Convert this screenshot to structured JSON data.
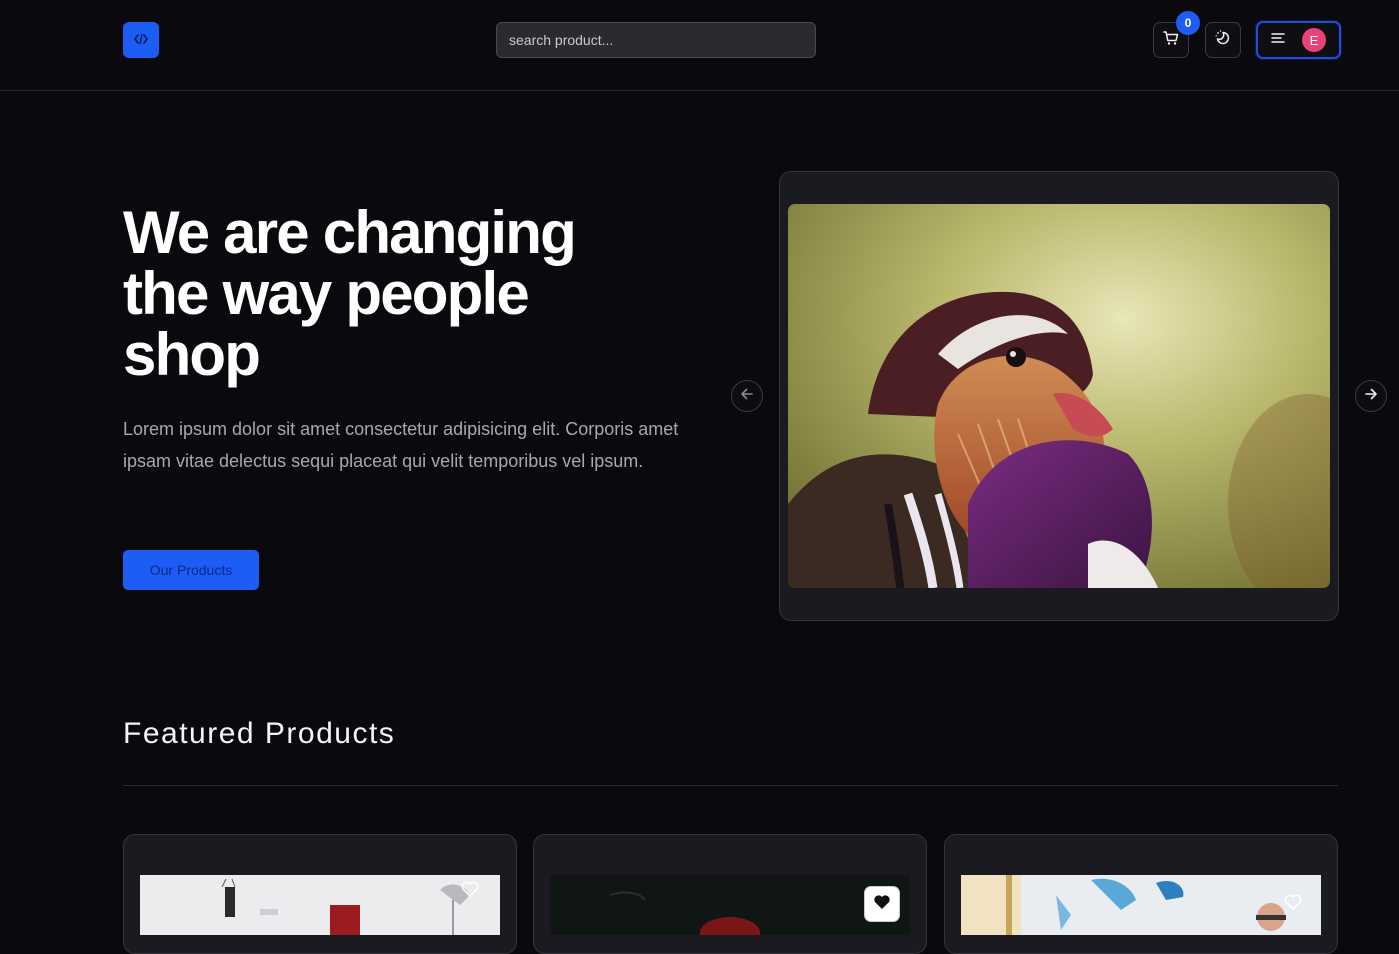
{
  "header": {
    "search_placeholder": "search product...",
    "cart_count": "0",
    "user_initial": "E"
  },
  "hero": {
    "title": "We are changing the way people shop",
    "description": "Lorem ipsum dolor sit amet consectetur adipisicing elit. Corporis amet ipsam vitae delectus sequi placeat qui velit temporibus vel ipsum.",
    "cta_label": "Our Products"
  },
  "featured": {
    "title": "Featured Products",
    "cards": [
      {
        "favorite_icon": "heart-outline-icon"
      },
      {
        "favorite_icon": "heart-filled-icon"
      },
      {
        "favorite_icon": "heart-outline-icon"
      }
    ]
  },
  "colors": {
    "accent": "#1d5cf5",
    "background": "#0a0a0e",
    "card": "#1a1a20",
    "avatar": "#e94179"
  }
}
